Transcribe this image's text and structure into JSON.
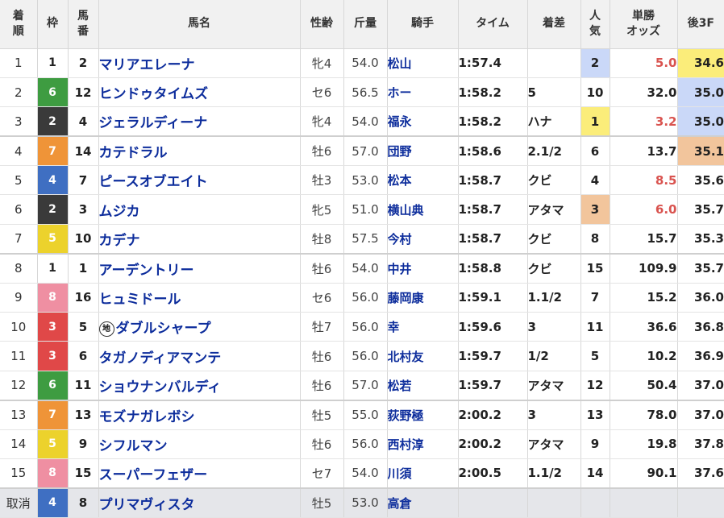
{
  "headers": {
    "rank": [
      "着",
      "順"
    ],
    "waku": "枠",
    "umaban": [
      "馬",
      "番"
    ],
    "name": "馬名",
    "sexage": "性齢",
    "weight": "斤量",
    "jockey": "騎手",
    "time": "タイム",
    "margin": "着差",
    "popularity": [
      "人",
      "気"
    ],
    "odds": [
      "単勝",
      "オッズ"
    ],
    "last3f": "後3F"
  },
  "colors": {
    "waku": {
      "1": {
        "bg": "#ffffff",
        "fg": "#222222"
      },
      "2": {
        "bg": "#3a3a3a",
        "fg": "#ffffff"
      },
      "3": {
        "bg": "#e04848",
        "fg": "#ffffff"
      },
      "4": {
        "bg": "#3f6fc2",
        "fg": "#ffffff"
      },
      "5": {
        "bg": "#ecd22c",
        "fg": "#ffffff"
      },
      "6": {
        "bg": "#3e9c41",
        "fg": "#ffffff"
      },
      "7": {
        "bg": "#ef9438",
        "fg": "#ffffff"
      },
      "8": {
        "bg": "#ef8fa2",
        "fg": "#ffffff"
      }
    },
    "popularity_highlight": {
      "1": "#fbed7a",
      "2": "#cad8f8",
      "3": "#f2c59c"
    },
    "last3f_highlight": {
      "1": "#fbed7a",
      "2": "#cad8f8",
      "3": "#f2c59c"
    },
    "odds_favored": "#d9534f",
    "odds_normal": "#222222"
  },
  "rows": [
    {
      "rank": "1",
      "waku": "1",
      "umaban": "2",
      "chiho": false,
      "name": "マリアエレーナ",
      "sexage": "牝4",
      "weight": "54.0",
      "jockey": "松山",
      "time": "1:57.4",
      "margin": "",
      "popularity": "2",
      "odds": "5.0",
      "odds_favored": true,
      "last3f": "34.6",
      "last3f_rank": "1",
      "group_sep": false,
      "scratched": false
    },
    {
      "rank": "2",
      "waku": "6",
      "umaban": "12",
      "chiho": false,
      "name": "ヒンドゥタイムズ",
      "sexage": "セ6",
      "weight": "56.5",
      "jockey": "ホー",
      "time": "1:58.2",
      "margin": "5",
      "popularity": "10",
      "odds": "32.0",
      "odds_favored": false,
      "last3f": "35.0",
      "last3f_rank": "2",
      "group_sep": false,
      "scratched": false
    },
    {
      "rank": "3",
      "waku": "2",
      "umaban": "4",
      "chiho": false,
      "name": "ジェラルディーナ",
      "sexage": "牝4",
      "weight": "54.0",
      "jockey": "福永",
      "time": "1:58.2",
      "margin": "ハナ",
      "popularity": "1",
      "odds": "3.2",
      "odds_favored": true,
      "last3f": "35.0",
      "last3f_rank": "2",
      "group_sep": false,
      "scratched": false
    },
    {
      "rank": "4",
      "waku": "7",
      "umaban": "14",
      "chiho": false,
      "name": "カテドラル",
      "sexage": "牡6",
      "weight": "57.0",
      "jockey": "団野",
      "time": "1:58.6",
      "margin": "2.1/2",
      "popularity": "6",
      "odds": "13.7",
      "odds_favored": false,
      "last3f": "35.1",
      "last3f_rank": "3",
      "group_sep": true,
      "scratched": false
    },
    {
      "rank": "5",
      "waku": "4",
      "umaban": "7",
      "chiho": false,
      "name": "ピースオブエイト",
      "sexage": "牡3",
      "weight": "53.0",
      "jockey": "松本",
      "time": "1:58.7",
      "margin": "クビ",
      "popularity": "4",
      "odds": "8.5",
      "odds_favored": true,
      "last3f": "35.6",
      "last3f_rank": "",
      "group_sep": false,
      "scratched": false
    },
    {
      "rank": "6",
      "waku": "2",
      "umaban": "3",
      "chiho": false,
      "name": "ムジカ",
      "sexage": "牝5",
      "weight": "51.0",
      "jockey": "横山典",
      "time": "1:58.7",
      "margin": "アタマ",
      "popularity": "3",
      "odds": "6.0",
      "odds_favored": true,
      "last3f": "35.7",
      "last3f_rank": "",
      "group_sep": false,
      "scratched": false
    },
    {
      "rank": "7",
      "waku": "5",
      "umaban": "10",
      "chiho": false,
      "name": "カデナ",
      "sexage": "牡8",
      "weight": "57.5",
      "jockey": "今村",
      "time": "1:58.7",
      "margin": "クビ",
      "popularity": "8",
      "odds": "15.7",
      "odds_favored": false,
      "last3f": "35.3",
      "last3f_rank": "",
      "group_sep": false,
      "scratched": false
    },
    {
      "rank": "8",
      "waku": "1",
      "umaban": "1",
      "chiho": false,
      "name": "アーデントリー",
      "sexage": "牡6",
      "weight": "54.0",
      "jockey": "中井",
      "time": "1:58.8",
      "margin": "クビ",
      "popularity": "15",
      "odds": "109.9",
      "odds_favored": false,
      "last3f": "35.7",
      "last3f_rank": "",
      "group_sep": true,
      "scratched": false
    },
    {
      "rank": "9",
      "waku": "8",
      "umaban": "16",
      "chiho": false,
      "name": "ヒュミドール",
      "sexage": "セ6",
      "weight": "56.0",
      "jockey": "藤岡康",
      "time": "1:59.1",
      "margin": "1.1/2",
      "popularity": "7",
      "odds": "15.2",
      "odds_favored": false,
      "last3f": "36.0",
      "last3f_rank": "",
      "group_sep": false,
      "scratched": false
    },
    {
      "rank": "10",
      "waku": "3",
      "umaban": "5",
      "chiho": true,
      "chiho_mark": "地",
      "name": "ダブルシャープ",
      "sexage": "牡7",
      "weight": "56.0",
      "jockey": "幸",
      "time": "1:59.6",
      "margin": "3",
      "popularity": "11",
      "odds": "36.6",
      "odds_favored": false,
      "last3f": "36.8",
      "last3f_rank": "",
      "group_sep": false,
      "scratched": false
    },
    {
      "rank": "11",
      "waku": "3",
      "umaban": "6",
      "chiho": false,
      "name": "タガノディアマンテ",
      "sexage": "牡6",
      "weight": "56.0",
      "jockey": "北村友",
      "time": "1:59.7",
      "margin": "1/2",
      "popularity": "5",
      "odds": "10.2",
      "odds_favored": false,
      "last3f": "36.9",
      "last3f_rank": "",
      "group_sep": false,
      "scratched": false
    },
    {
      "rank": "12",
      "waku": "6",
      "umaban": "11",
      "chiho": false,
      "name": "ショウナンバルディ",
      "sexage": "牡6",
      "weight": "57.0",
      "jockey": "松若",
      "time": "1:59.7",
      "margin": "アタマ",
      "popularity": "12",
      "odds": "50.4",
      "odds_favored": false,
      "last3f": "37.0",
      "last3f_rank": "",
      "group_sep": false,
      "scratched": false
    },
    {
      "rank": "13",
      "waku": "7",
      "umaban": "13",
      "chiho": false,
      "name": "モズナガレボシ",
      "sexage": "牡5",
      "weight": "55.0",
      "jockey": "荻野極",
      "time": "2:00.2",
      "margin": "3",
      "popularity": "13",
      "odds": "78.0",
      "odds_favored": false,
      "last3f": "37.0",
      "last3f_rank": "",
      "group_sep": true,
      "scratched": false
    },
    {
      "rank": "14",
      "waku": "5",
      "umaban": "9",
      "chiho": false,
      "name": "シフルマン",
      "sexage": "牡6",
      "weight": "56.0",
      "jockey": "西村淳",
      "time": "2:00.2",
      "margin": "アタマ",
      "popularity": "9",
      "odds": "19.8",
      "odds_favored": false,
      "last3f": "37.8",
      "last3f_rank": "",
      "group_sep": false,
      "scratched": false
    },
    {
      "rank": "15",
      "waku": "8",
      "umaban": "15",
      "chiho": false,
      "name": "スーパーフェザー",
      "sexage": "セ7",
      "weight": "54.0",
      "jockey": "川須",
      "time": "2:00.5",
      "margin": "1.1/2",
      "popularity": "14",
      "odds": "90.1",
      "odds_favored": false,
      "last3f": "37.6",
      "last3f_rank": "",
      "group_sep": false,
      "scratched": false
    },
    {
      "rank": "取消",
      "waku": "4",
      "umaban": "8",
      "chiho": false,
      "name": "プリマヴィスタ",
      "sexage": "牡5",
      "weight": "53.0",
      "jockey": "高倉",
      "time": "",
      "margin": "",
      "popularity": "",
      "odds": "",
      "odds_favored": false,
      "last3f": "",
      "last3f_rank": "",
      "group_sep": true,
      "scratched": true
    }
  ]
}
